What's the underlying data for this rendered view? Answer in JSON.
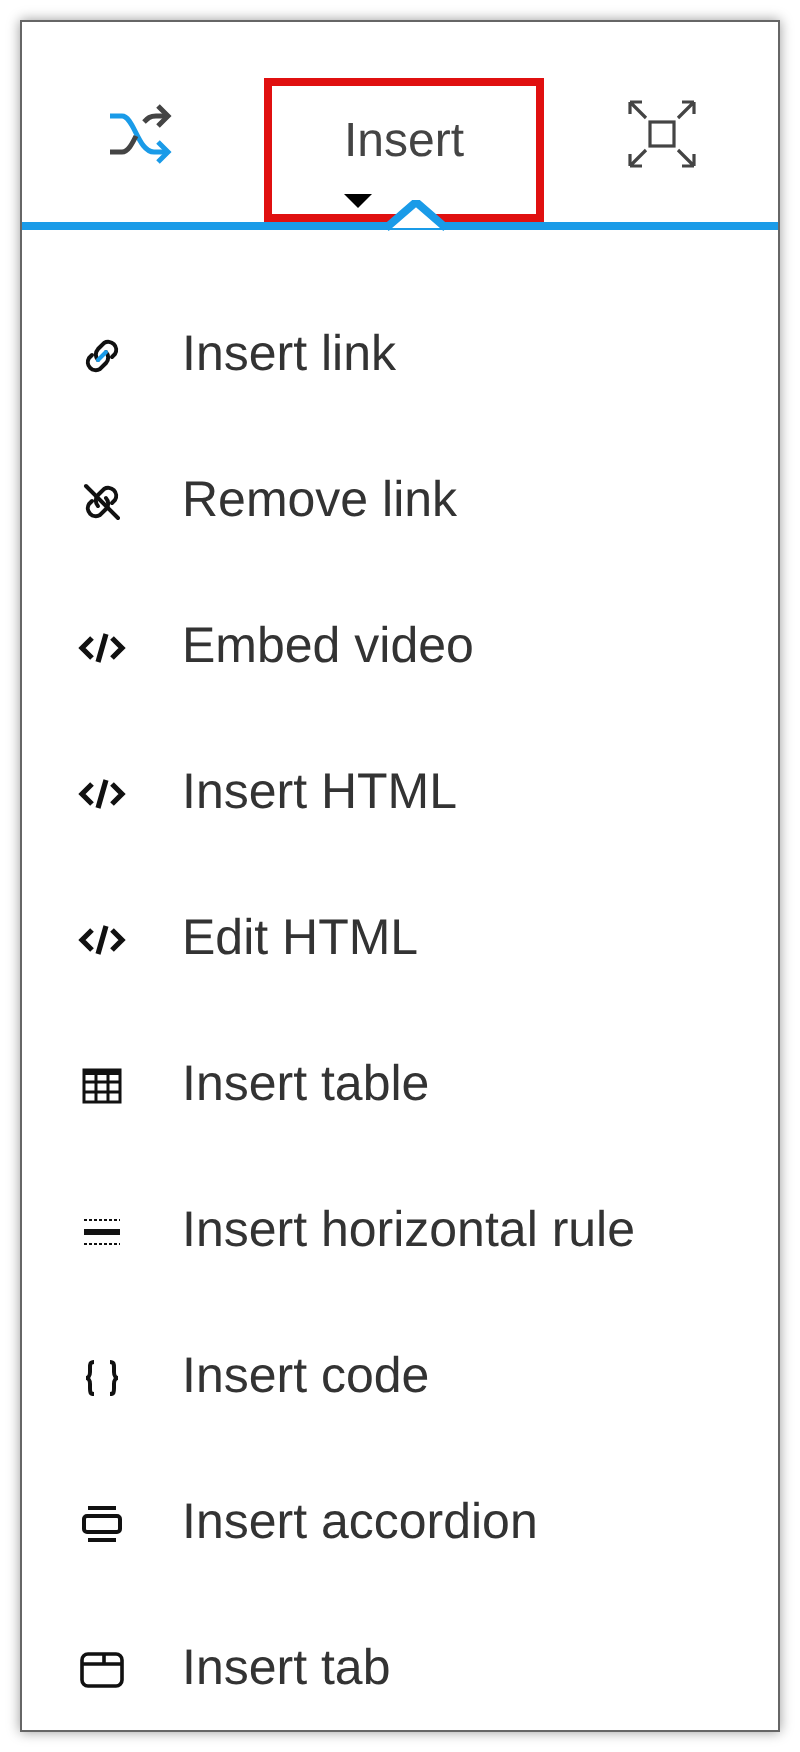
{
  "toolbar": {
    "tab": {
      "label": "Insert",
      "selected": true,
      "highlighted": true
    }
  },
  "menu": [
    {
      "kind": "link",
      "label": "Insert link"
    },
    {
      "kind": "unlink",
      "label": "Remove link"
    },
    {
      "kind": "code",
      "label": "Embed video"
    },
    {
      "kind": "code",
      "label": "Insert HTML"
    },
    {
      "kind": "code",
      "label": "Edit HTML"
    },
    {
      "kind": "table",
      "label": "Insert table"
    },
    {
      "kind": "rule",
      "label": "Insert horizontal rule"
    },
    {
      "kind": "braces",
      "label": "Insert code"
    },
    {
      "kind": "accordion",
      "label": "Insert accordion"
    },
    {
      "kind": "tab",
      "label": "Insert tab"
    }
  ]
}
